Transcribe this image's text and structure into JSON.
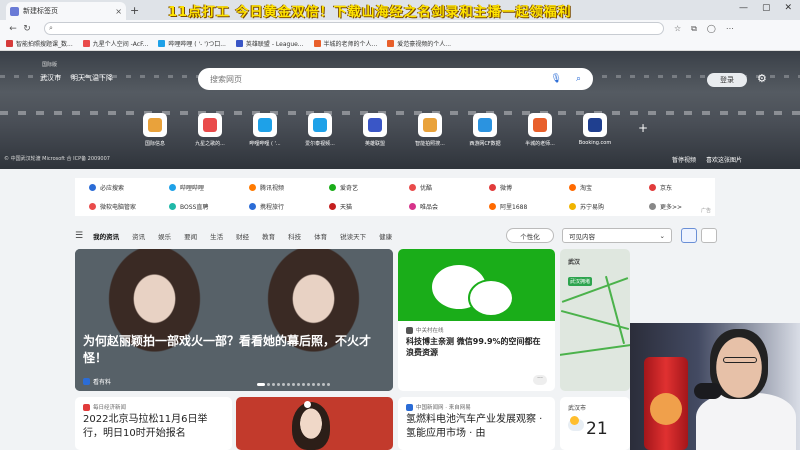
{
  "browser": {
    "tab_title": "新建标签页",
    "tab_close": "×",
    "new_tab": "+",
    "address_placeholder": "",
    "win_controls": [
      "—",
      "▢",
      "✕"
    ]
  },
  "overlay_banner": "11点打工    今日黄金双倍！下载山海经之名剑录和主播一起领福利",
  "favorites": [
    {
      "label": "智能拍照搜题课_数...",
      "color": "#d63b3b"
    },
    {
      "label": "九星个人空间 -AcF...",
      "color": "#e94b4b"
    },
    {
      "label": "哔哩哔哩 ( '- ')つ口...",
      "color": "#1ea1e8"
    },
    {
      "label": "英雄联盟 - League...",
      "color": "#3a56c6"
    },
    {
      "label": "半城的老师的个人...",
      "color": "#e85f2b"
    },
    {
      "label": "爱范豪视频的个人...",
      "color": "#e85f2b"
    }
  ],
  "hero": {
    "ms_label": "国际版",
    "city": "武汉市",
    "weather": "明天气温下降",
    "search_placeholder": "搜索网页",
    "login": "登录",
    "tiles": [
      {
        "label": "国际信息",
        "color": "#e9a23b"
      },
      {
        "label": "九星之歌的...",
        "color": "#e94b4b"
      },
      {
        "label": "哔哩哔哩 ( '...",
        "color": "#1ea1e8"
      },
      {
        "label": "爱尔泰视频...",
        "color": "#1ea1e8"
      },
      {
        "label": "英雄联盟",
        "color": "#3a56c6"
      },
      {
        "label": "智能拍照搜...",
        "color": "#e9a23b"
      },
      {
        "label": "西游网CF数据",
        "color": "#2b93e0"
      },
      {
        "label": "半城的老师...",
        "color": "#e85f2b"
      },
      {
        "label": "Booking.com",
        "color": "#1f3f8f"
      }
    ],
    "note": "© 中国武汉轮渡 Microsoft 合 ICP备 2009007",
    "pause": "暂停视频",
    "like": "喜欢这张图片"
  },
  "quick_links": [
    [
      {
        "label": "必应搜索",
        "color": "#2b6cd6"
      },
      {
        "label": "哔哩哔哩",
        "color": "#1ea1e8"
      },
      {
        "label": "腾讯视频",
        "color": "#ff7a00"
      },
      {
        "label": "爱奇艺",
        "color": "#1aad19"
      },
      {
        "label": "优酷",
        "color": "#e94b4b"
      },
      {
        "label": "微博",
        "color": "#e13b3b"
      },
      {
        "label": "淘宝",
        "color": "#ff6a00"
      },
      {
        "label": "京东",
        "color": "#e13b3b"
      }
    ],
    [
      {
        "label": "微软电脑管家",
        "color": "#e94b4b"
      },
      {
        "label": "BOSS直聘",
        "color": "#1fb8a8"
      },
      {
        "label": "携程旅行",
        "color": "#2b6cd6"
      },
      {
        "label": "天猫",
        "color": "#c41e1e"
      },
      {
        "label": "唯品会",
        "color": "#d6338a"
      },
      {
        "label": "阿里1688",
        "color": "#ff6a00"
      },
      {
        "label": "苏宁易购",
        "color": "#f0b400"
      },
      {
        "label": "更多>>",
        "color": "#888888"
      }
    ]
  ],
  "ad_label": "广告",
  "categories": [
    "我的资讯",
    "资讯",
    "娱乐",
    "要闻",
    "生活",
    "财经",
    "教育",
    "科技",
    "体育",
    "锐读天下",
    "健康"
  ],
  "personalize": "个性化",
  "visibility": "可见内容",
  "cards": {
    "main": {
      "title": "为何赵丽颖拍一部戏火一部？看看她的幕后照，不火才怪！",
      "source": "看有料"
    },
    "wechat": {
      "source": "中关村在线",
      "title": "科技博主亲测 微信99.9%的空间都在浪费资源",
      "more": "···"
    },
    "map": {
      "city": "武汉",
      "badge": "武汉拥堵"
    },
    "marathon": {
      "source": "每日经济新闻",
      "title": "2022北京马拉松11月6日举行，明日10时开始报名"
    },
    "hydrogen": {
      "source": "中国新闻网 · 来自网易",
      "title": "氢燃料电池汽车产业发展观察 · 氢能应用市场 · 由"
    },
    "weather": {
      "city": "武汉市",
      "temp": "21"
    }
  }
}
